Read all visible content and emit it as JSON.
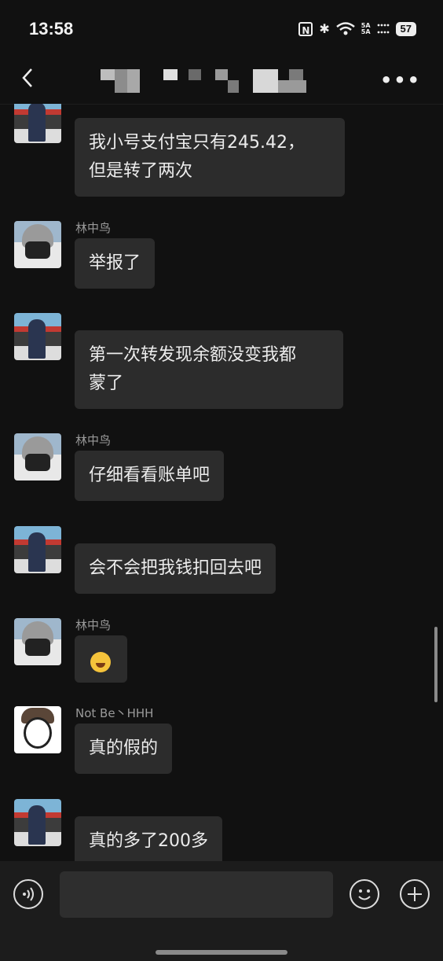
{
  "status_bar": {
    "time": "13:58",
    "nfc": "N",
    "bluetooth": "✱",
    "signal_1": "5A",
    "signal_2": "5A",
    "battery": "57"
  },
  "nav": {
    "back_icon": "chevron-left-icon",
    "more_icon": "more-dots-icon",
    "more_glyph": "•••"
  },
  "messages": [
    {
      "sender": "",
      "text": "我小号支付宝只有245.42，\n但是转了两次"
    },
    {
      "sender": "林中鸟",
      "text": "举报了"
    },
    {
      "sender": "",
      "text": "第一次转发现余额没变我都\n蒙了"
    },
    {
      "sender": "林中鸟",
      "text": "仔细看看账单吧"
    },
    {
      "sender": "",
      "text": "会不会把我钱扣回去吧"
    },
    {
      "sender": "林中鸟",
      "text": "",
      "emoji": "laughing-tears-emoji"
    },
    {
      "sender": "Not Be丶HHH",
      "text": "真的假的"
    },
    {
      "sender": "",
      "text": "真的多了200多"
    }
  ],
  "input": {
    "voice_icon": "voice-icon",
    "emoji_icon": "smile-icon",
    "plus_icon": "plus-icon",
    "placeholder": ""
  },
  "colors": {
    "background": "#111111",
    "bubble": "#2c2c2c",
    "sender_text": "#9a9a9a"
  }
}
